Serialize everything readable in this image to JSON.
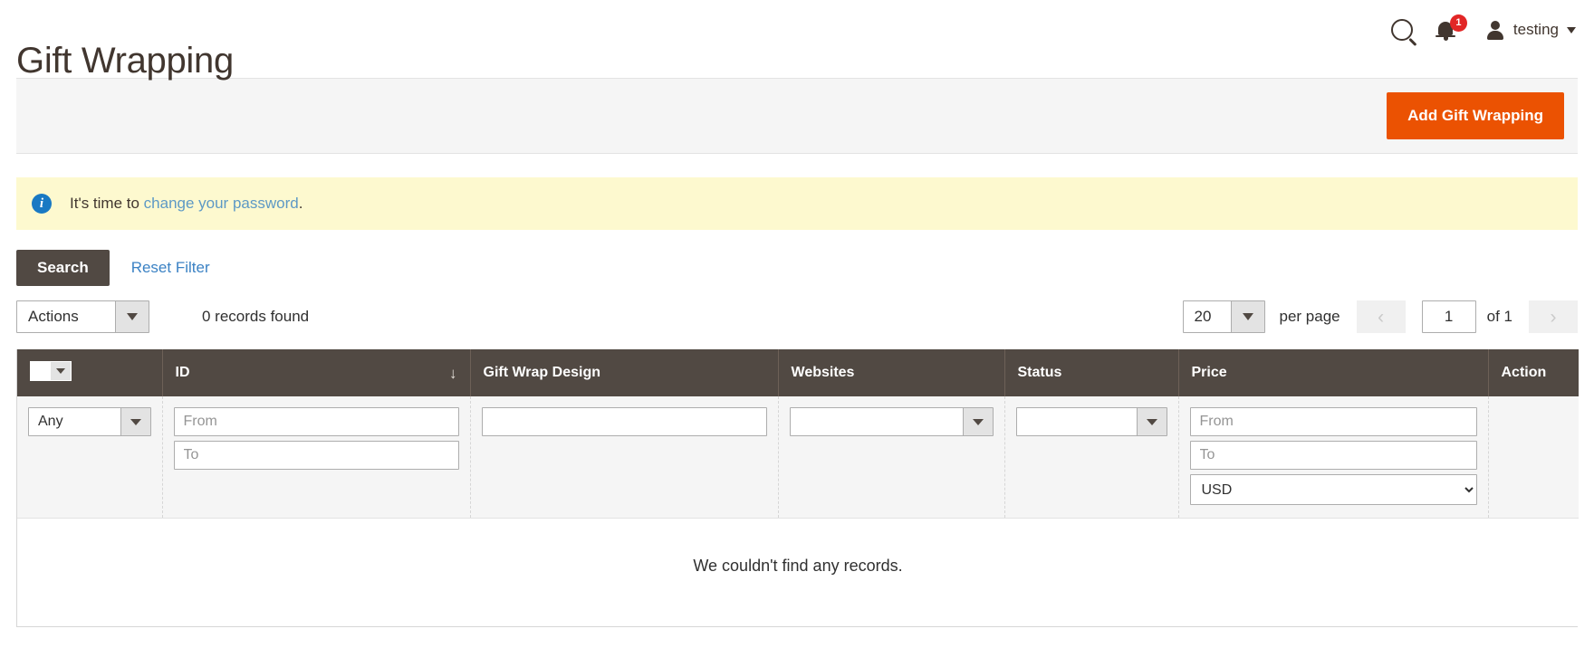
{
  "header": {
    "title": "Gift Wrapping",
    "search_icon": "search-icon",
    "notifications": {
      "icon": "bell-icon",
      "count": "1"
    },
    "user": {
      "avatar_icon": "user-avatar-icon",
      "name": "testing",
      "caret_icon": "chevron-down-icon"
    }
  },
  "page_actions": {
    "add_button_label": "Add Gift Wrapping"
  },
  "message": {
    "icon": "info-icon",
    "prefix": "It's time to ",
    "link_text": "change your password",
    "suffix": "."
  },
  "grid_actions": {
    "search_label": "Search",
    "reset_filter_label": "Reset Filter"
  },
  "grid_header": {
    "massaction_label": "Actions",
    "records_found": "0 records found",
    "pager": {
      "per_page_value": "20",
      "per_page_label": "per page",
      "prev_icon": "chevron-left-icon",
      "next_icon": "chevron-right-icon",
      "current_page": "1",
      "of_total": "of 1"
    }
  },
  "grid": {
    "columns": [
      {
        "label": "",
        "name": "massaction"
      },
      {
        "label": "ID",
        "name": "id",
        "sort": "↓"
      },
      {
        "label": "Gift Wrap Design",
        "name": "gift-wrap-design"
      },
      {
        "label": "Websites",
        "name": "websites"
      },
      {
        "label": "Status",
        "name": "status"
      },
      {
        "label": "Price",
        "name": "price"
      },
      {
        "label": "Action",
        "name": "action"
      }
    ],
    "filters": {
      "massaction_select": "Any",
      "id_from_placeholder": "From",
      "id_to_placeholder": "To",
      "design_value": "",
      "websites_select": "",
      "status_select": "",
      "price_from_placeholder": "From",
      "price_to_placeholder": "To",
      "currency_value": "USD"
    },
    "empty_text": "We couldn't find any records."
  },
  "colors": {
    "accent_orange": "#eb5202",
    "header_dark": "#514943",
    "link_blue": "#3b82c4",
    "notice_yellow": "#fdf9cf",
    "badge_red": "#e22626"
  }
}
